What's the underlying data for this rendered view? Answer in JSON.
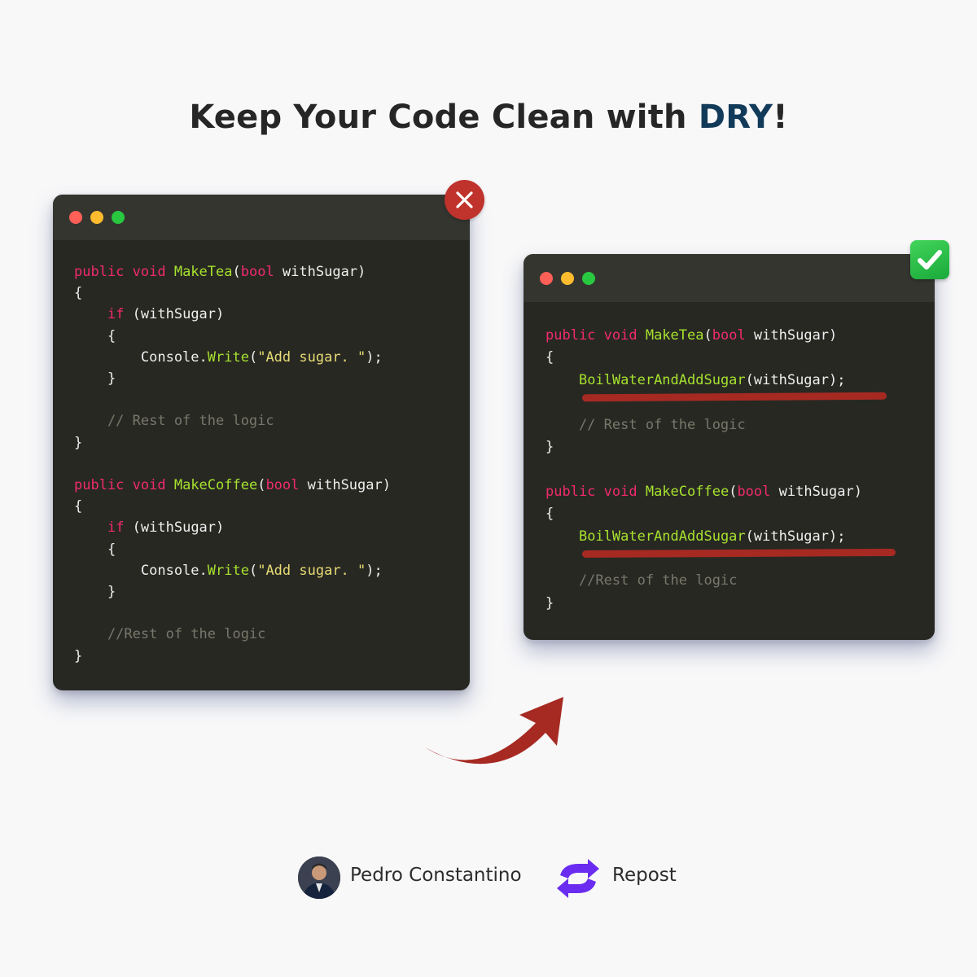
{
  "headline": {
    "prefix": "Keep Your Code Clean with ",
    "accent": "DRY",
    "suffix": "!"
  },
  "bad_window": {
    "lines": [
      [
        {
          "t": "public void ",
          "c": "kw"
        },
        {
          "t": "MakeTea",
          "c": "fn"
        },
        {
          "t": "(",
          "c": "pl"
        },
        {
          "t": "bool",
          "c": "kw"
        },
        {
          "t": " withSugar)",
          "c": "pl"
        }
      ],
      [
        {
          "t": "{",
          "c": "pl"
        }
      ],
      [
        {
          "t": "    ",
          "c": "pl"
        },
        {
          "t": "if",
          "c": "kw"
        },
        {
          "t": " (withSugar)",
          "c": "pl"
        }
      ],
      [
        {
          "t": "    {",
          "c": "pl"
        }
      ],
      [
        {
          "t": "        Console.",
          "c": "pl"
        },
        {
          "t": "Write",
          "c": "fn"
        },
        {
          "t": "(",
          "c": "pl"
        },
        {
          "t": "\"Add sugar. \"",
          "c": "str"
        },
        {
          "t": ");",
          "c": "pl"
        }
      ],
      [
        {
          "t": "    }",
          "c": "pl"
        }
      ],
      [],
      [
        {
          "t": "    // Rest of the logic",
          "c": "cm"
        }
      ],
      [
        {
          "t": "}",
          "c": "pl"
        }
      ],
      [],
      [
        {
          "t": "public void ",
          "c": "kw"
        },
        {
          "t": "MakeCoffee",
          "c": "fn"
        },
        {
          "t": "(",
          "c": "pl"
        },
        {
          "t": "bool",
          "c": "kw"
        },
        {
          "t": " withSugar)",
          "c": "pl"
        }
      ],
      [
        {
          "t": "{",
          "c": "pl"
        }
      ],
      [
        {
          "t": "    ",
          "c": "pl"
        },
        {
          "t": "if",
          "c": "kw"
        },
        {
          "t": " (withSugar)",
          "c": "pl"
        }
      ],
      [
        {
          "t": "    {",
          "c": "pl"
        }
      ],
      [
        {
          "t": "        Console.",
          "c": "pl"
        },
        {
          "t": "Write",
          "c": "fn"
        },
        {
          "t": "(",
          "c": "pl"
        },
        {
          "t": "\"Add sugar. \"",
          "c": "str"
        },
        {
          "t": ");",
          "c": "pl"
        }
      ],
      [
        {
          "t": "    }",
          "c": "pl"
        }
      ],
      [],
      [
        {
          "t": "    //Rest of the logic",
          "c": "cm"
        }
      ],
      [
        {
          "t": "}",
          "c": "pl"
        }
      ]
    ]
  },
  "good_window": {
    "lines": [
      [
        {
          "t": "public void ",
          "c": "kw"
        },
        {
          "t": "MakeTea",
          "c": "fn"
        },
        {
          "t": "(",
          "c": "pl"
        },
        {
          "t": "bool",
          "c": "kw"
        },
        {
          "t": " withSugar)",
          "c": "pl"
        }
      ],
      [
        {
          "t": "{",
          "c": "pl"
        }
      ],
      [
        {
          "t": "    ",
          "c": "pl"
        },
        {
          "t": "BoilWaterAndAddSugar",
          "c": "fn"
        },
        {
          "t": "(withSugar);",
          "c": "pl"
        }
      ],
      [],
      [
        {
          "t": "    // Rest of the logic",
          "c": "cm"
        }
      ],
      [
        {
          "t": "}",
          "c": "pl"
        }
      ],
      [],
      [
        {
          "t": "public void ",
          "c": "kw"
        },
        {
          "t": "MakeCoffee",
          "c": "fn"
        },
        {
          "t": "(",
          "c": "pl"
        },
        {
          "t": "bool",
          "c": "kw"
        },
        {
          "t": " withSugar)",
          "c": "pl"
        }
      ],
      [
        {
          "t": "{",
          "c": "pl"
        }
      ],
      [
        {
          "t": "    ",
          "c": "pl"
        },
        {
          "t": "BoilWaterAndAddSugar",
          "c": "fn"
        },
        {
          "t": "(withSugar);",
          "c": "pl"
        }
      ],
      [],
      [
        {
          "t": "    //Rest of the logic",
          "c": "cm"
        }
      ],
      [
        {
          "t": "}",
          "c": "pl"
        }
      ]
    ]
  },
  "icons": {
    "bad_badge": "close-icon",
    "good_badge": "checkmark-icon",
    "arrow": "curved-arrow-icon",
    "repost": "repost-icon"
  },
  "colors": {
    "keyword": "#f02a6e",
    "function": "#a6e22e",
    "string": "#e6db74",
    "comment": "#77776a",
    "accent": "#123a59",
    "marker": "#a62a22",
    "repost": "#6a2cf0"
  },
  "footer": {
    "author": "Pedro Constantino",
    "repost_label": "Repost"
  }
}
